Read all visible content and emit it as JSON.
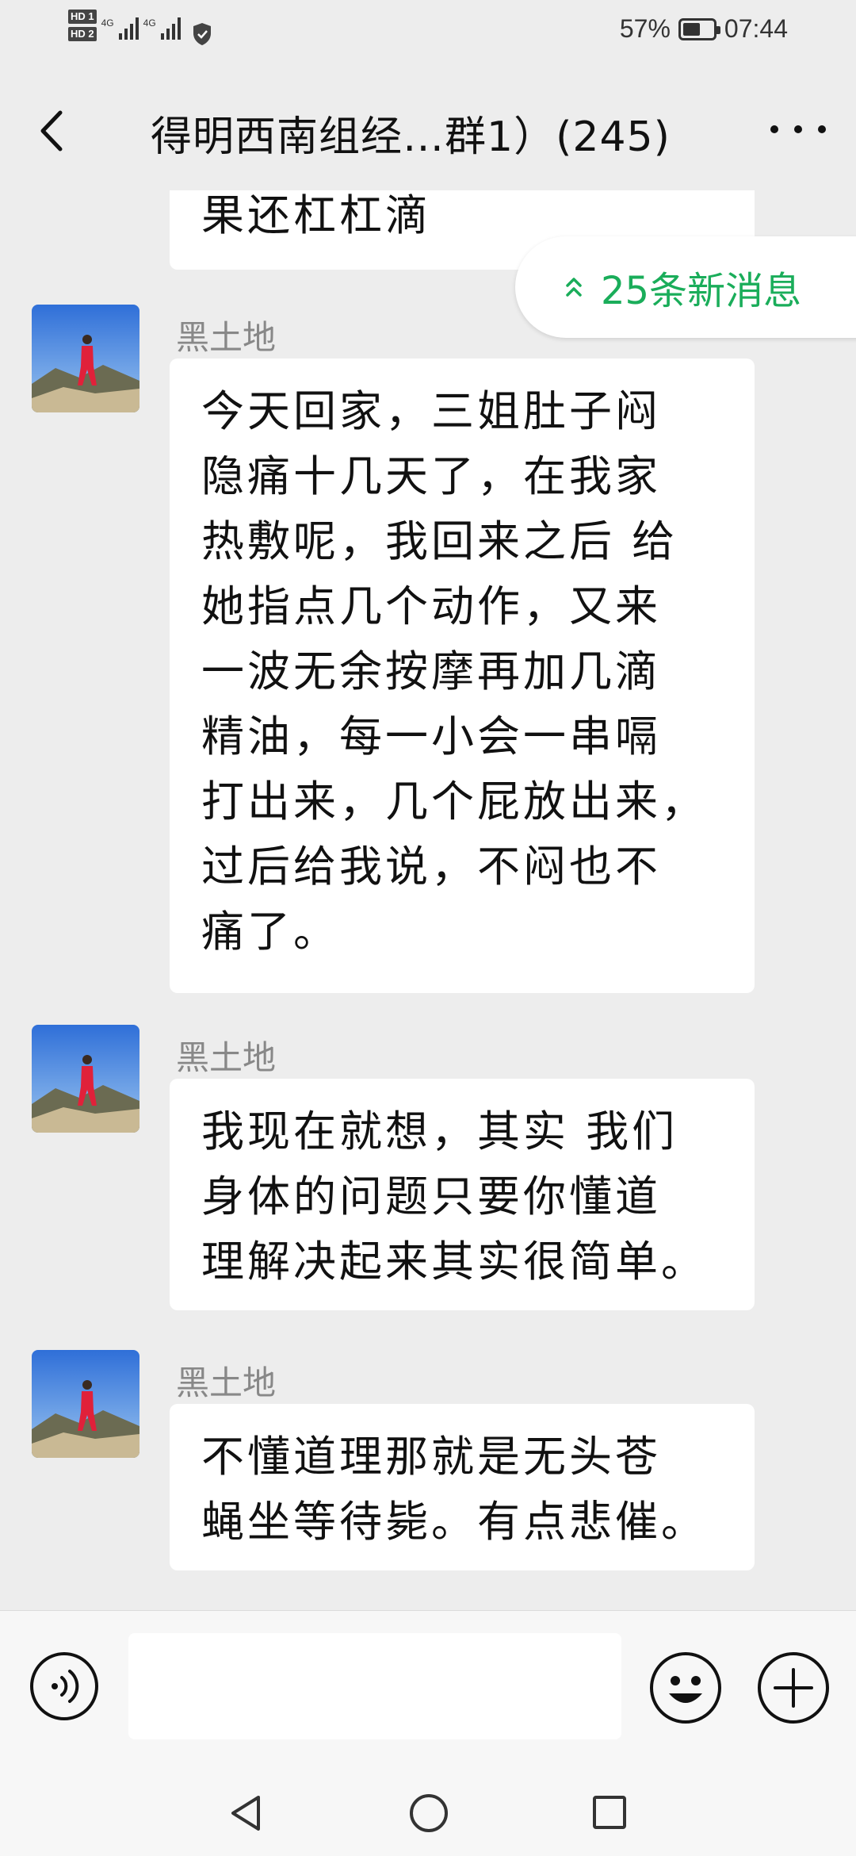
{
  "status_bar": {
    "hd1": "HD 1",
    "hd2": "HD 2",
    "net1": "4G",
    "net2": "4G",
    "battery": "57%",
    "battery_level": 0.57,
    "time": "07:44"
  },
  "header": {
    "title": "得明西南组经…群1）(245)"
  },
  "new_messages": {
    "label": "25条新消息"
  },
  "messages": [
    {
      "lines": [
        "果还杠杠滴"
      ]
    },
    {
      "sender": "黑土地",
      "lines": [
        "今天回家，三姐肚子闷",
        "隐痛十几天了，在我家",
        "热敷呢，我回来之后 给",
        "她指点几个动作，又来",
        "一波无余按摩再加几滴",
        "精油，每一小会一串嗝",
        "打出来，几个屁放出来，",
        "过后给我说，不闷也不",
        "痛了。"
      ]
    },
    {
      "sender": "黑土地",
      "lines": [
        "我现在就想，其实 我们",
        "身体的问题只要你懂道",
        "理解决起来其实很简单。"
      ]
    },
    {
      "sender": "黑土地",
      "lines": [
        "不懂道理那就是无头苍",
        "蝇坐等待毙。有点悲催。"
      ]
    }
  ],
  "input_bar": {
    "placeholder": ""
  },
  "colors": {
    "accent_green": "#1aad5a",
    "background": "#ededed",
    "bubble": "#ffffff"
  },
  "icons": [
    "back-arrow-icon",
    "more-dots-icon",
    "double-chevron-up-icon",
    "voice-icon",
    "emoji-icon",
    "plus-icon",
    "nav-back-icon",
    "nav-home-icon",
    "nav-recent-icon"
  ]
}
